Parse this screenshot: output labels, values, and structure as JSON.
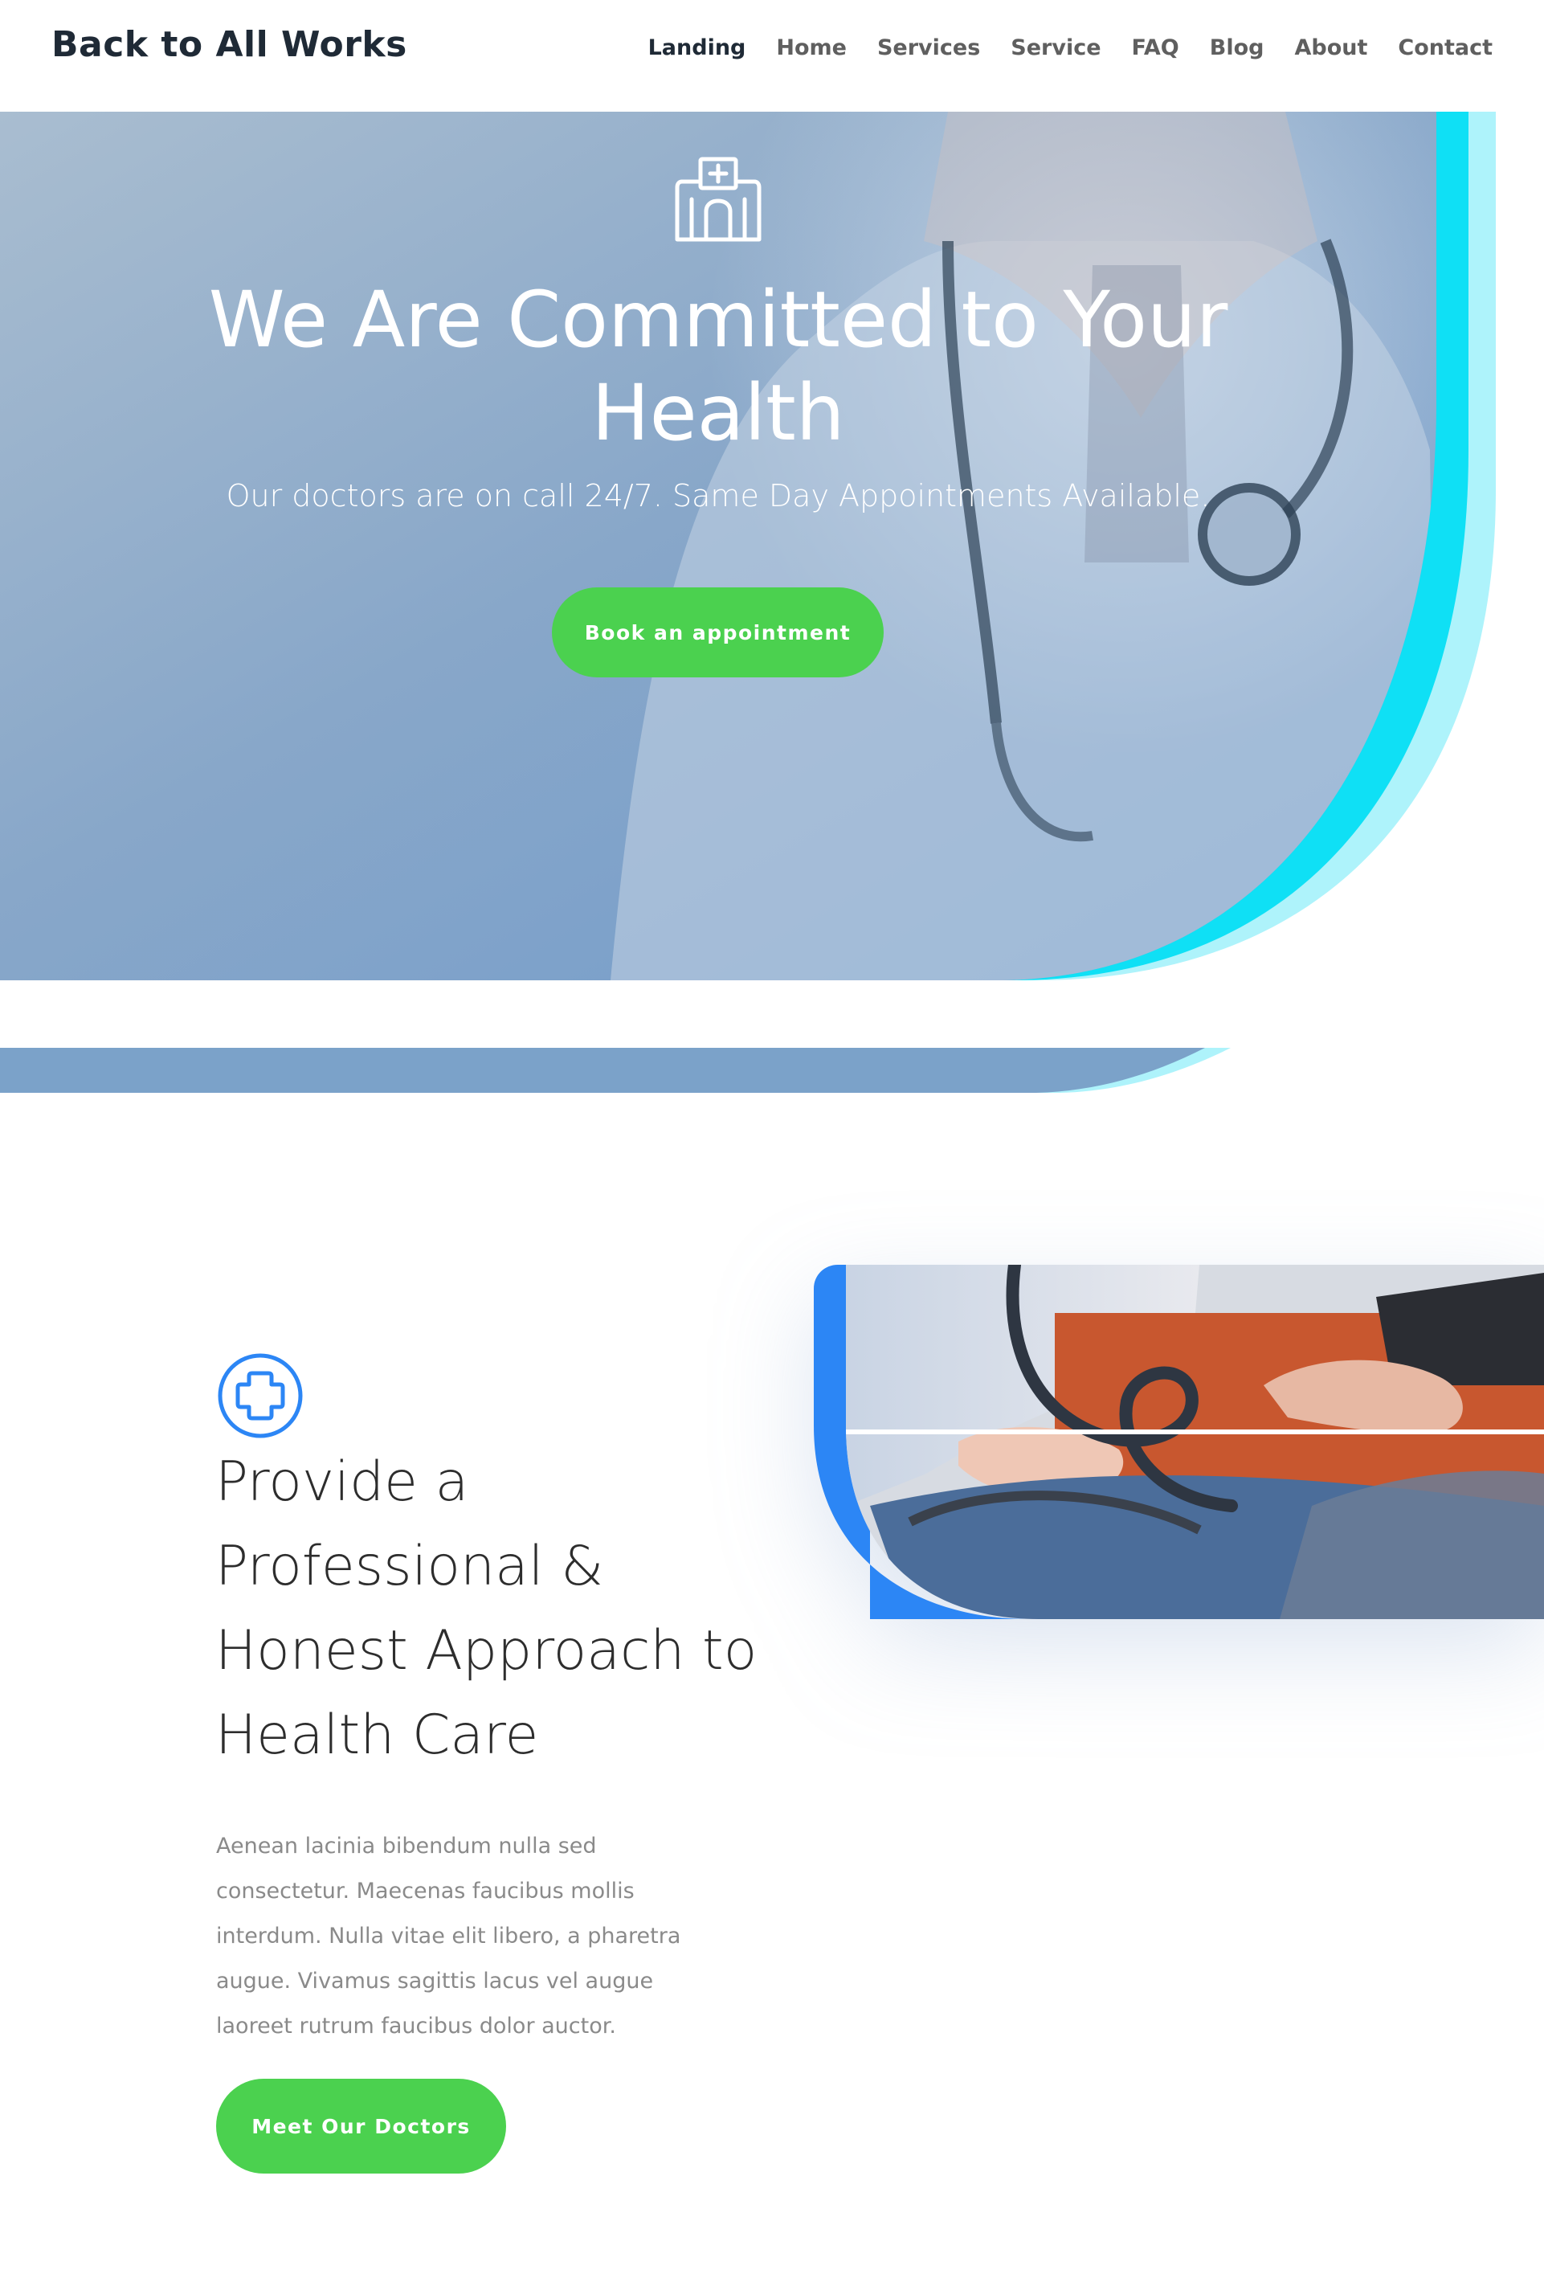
{
  "header": {
    "site_title": "Back to All Works",
    "nav": [
      {
        "label": "Landing",
        "active": true
      },
      {
        "label": "Home",
        "active": false
      },
      {
        "label": "Services",
        "active": false
      },
      {
        "label": "Service",
        "active": false
      },
      {
        "label": "FAQ",
        "active": false
      },
      {
        "label": "Blog",
        "active": false
      },
      {
        "label": "About",
        "active": false
      },
      {
        "label": "Contact",
        "active": false
      }
    ]
  },
  "hero": {
    "icon": "hospital-icon",
    "title": "We Are Committed to Your Health",
    "subtitle": "Our doctors are on call 24/7. Same Day Appointments Available.",
    "cta_label": "Book an appointment"
  },
  "about": {
    "icon": "medical-cross-icon",
    "title": "Provide a Professional & Honest Approach to Health Care",
    "body": "Aenean lacinia bibendum nulla sed consectetur. Maecenas faucibus mollis interdum. Nulla vitae elit libero, a pharetra augue. Vivamus sagittis lacus vel augue laoreet rutrum faucibus dolor auctor.",
    "cta_label": "Meet Our Doctors",
    "image": "blood-pressure-check-photo"
  },
  "colors": {
    "accent_green": "#4bd14f",
    "accent_cyan": "#0fe0f5",
    "accent_light_cyan": "#aef3fb",
    "accent_blue": "#2c86f5",
    "heading_dark": "#1f2a36"
  }
}
